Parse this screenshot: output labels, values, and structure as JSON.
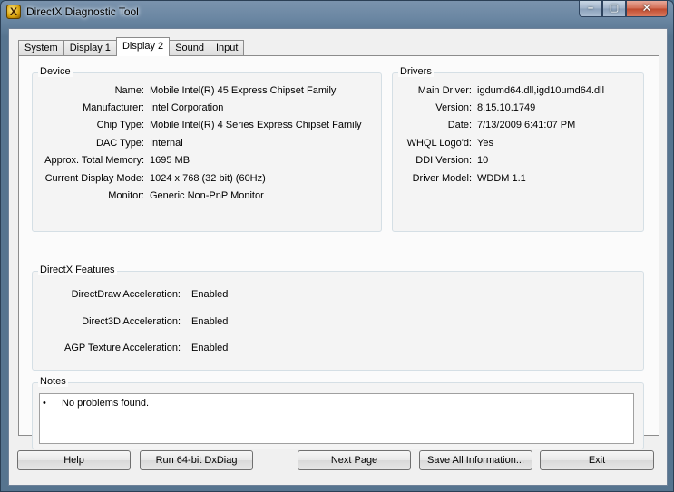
{
  "window": {
    "title": "DirectX Diagnostic Tool",
    "app_icon": "X"
  },
  "caption": {
    "minimize": "–",
    "maximize": "▢",
    "close": "✕"
  },
  "tabs": [
    "System",
    "Display 1",
    "Display 2",
    "Sound",
    "Input"
  ],
  "active_tab": "Display 2",
  "device": {
    "title": "Device",
    "rows": [
      {
        "label": "Name:",
        "value": "Mobile Intel(R) 45 Express Chipset Family"
      },
      {
        "label": "Manufacturer:",
        "value": "Intel Corporation"
      },
      {
        "label": "Chip Type:",
        "value": "Mobile Intel(R) 4 Series Express Chipset Family"
      },
      {
        "label": "DAC Type:",
        "value": "Internal"
      },
      {
        "label": "Approx. Total Memory:",
        "value": "1695 MB"
      },
      {
        "label": "Current Display Mode:",
        "value": "1024 x 768 (32 bit) (60Hz)"
      },
      {
        "label": "Monitor:",
        "value": "Generic Non-PnP Monitor"
      }
    ]
  },
  "drivers": {
    "title": "Drivers",
    "rows": [
      {
        "label": "Main Driver:",
        "value": "igdumd64.dll,igd10umd64.dll"
      },
      {
        "label": "Version:",
        "value": "8.15.10.1749"
      },
      {
        "label": "Date:",
        "value": "7/13/2009 6:41:07 PM"
      },
      {
        "label": "WHQL Logo'd:",
        "value": "Yes"
      },
      {
        "label": "DDI Version:",
        "value": "10"
      },
      {
        "label": "Driver Model:",
        "value": "WDDM 1.1"
      }
    ]
  },
  "features": {
    "title": "DirectX Features",
    "rows": [
      {
        "label": "DirectDraw Acceleration:",
        "value": "Enabled"
      },
      {
        "label": "Direct3D Acceleration:",
        "value": "Enabled"
      },
      {
        "label": "AGP Texture Acceleration:",
        "value": "Enabled"
      }
    ]
  },
  "notes": {
    "title": "Notes",
    "bullet": "•",
    "text": "No problems found."
  },
  "buttons": {
    "help": "Help",
    "run64": "Run 64-bit DxDiag",
    "next_page": "Next Page",
    "save_all": "Save All Information...",
    "exit": "Exit"
  }
}
